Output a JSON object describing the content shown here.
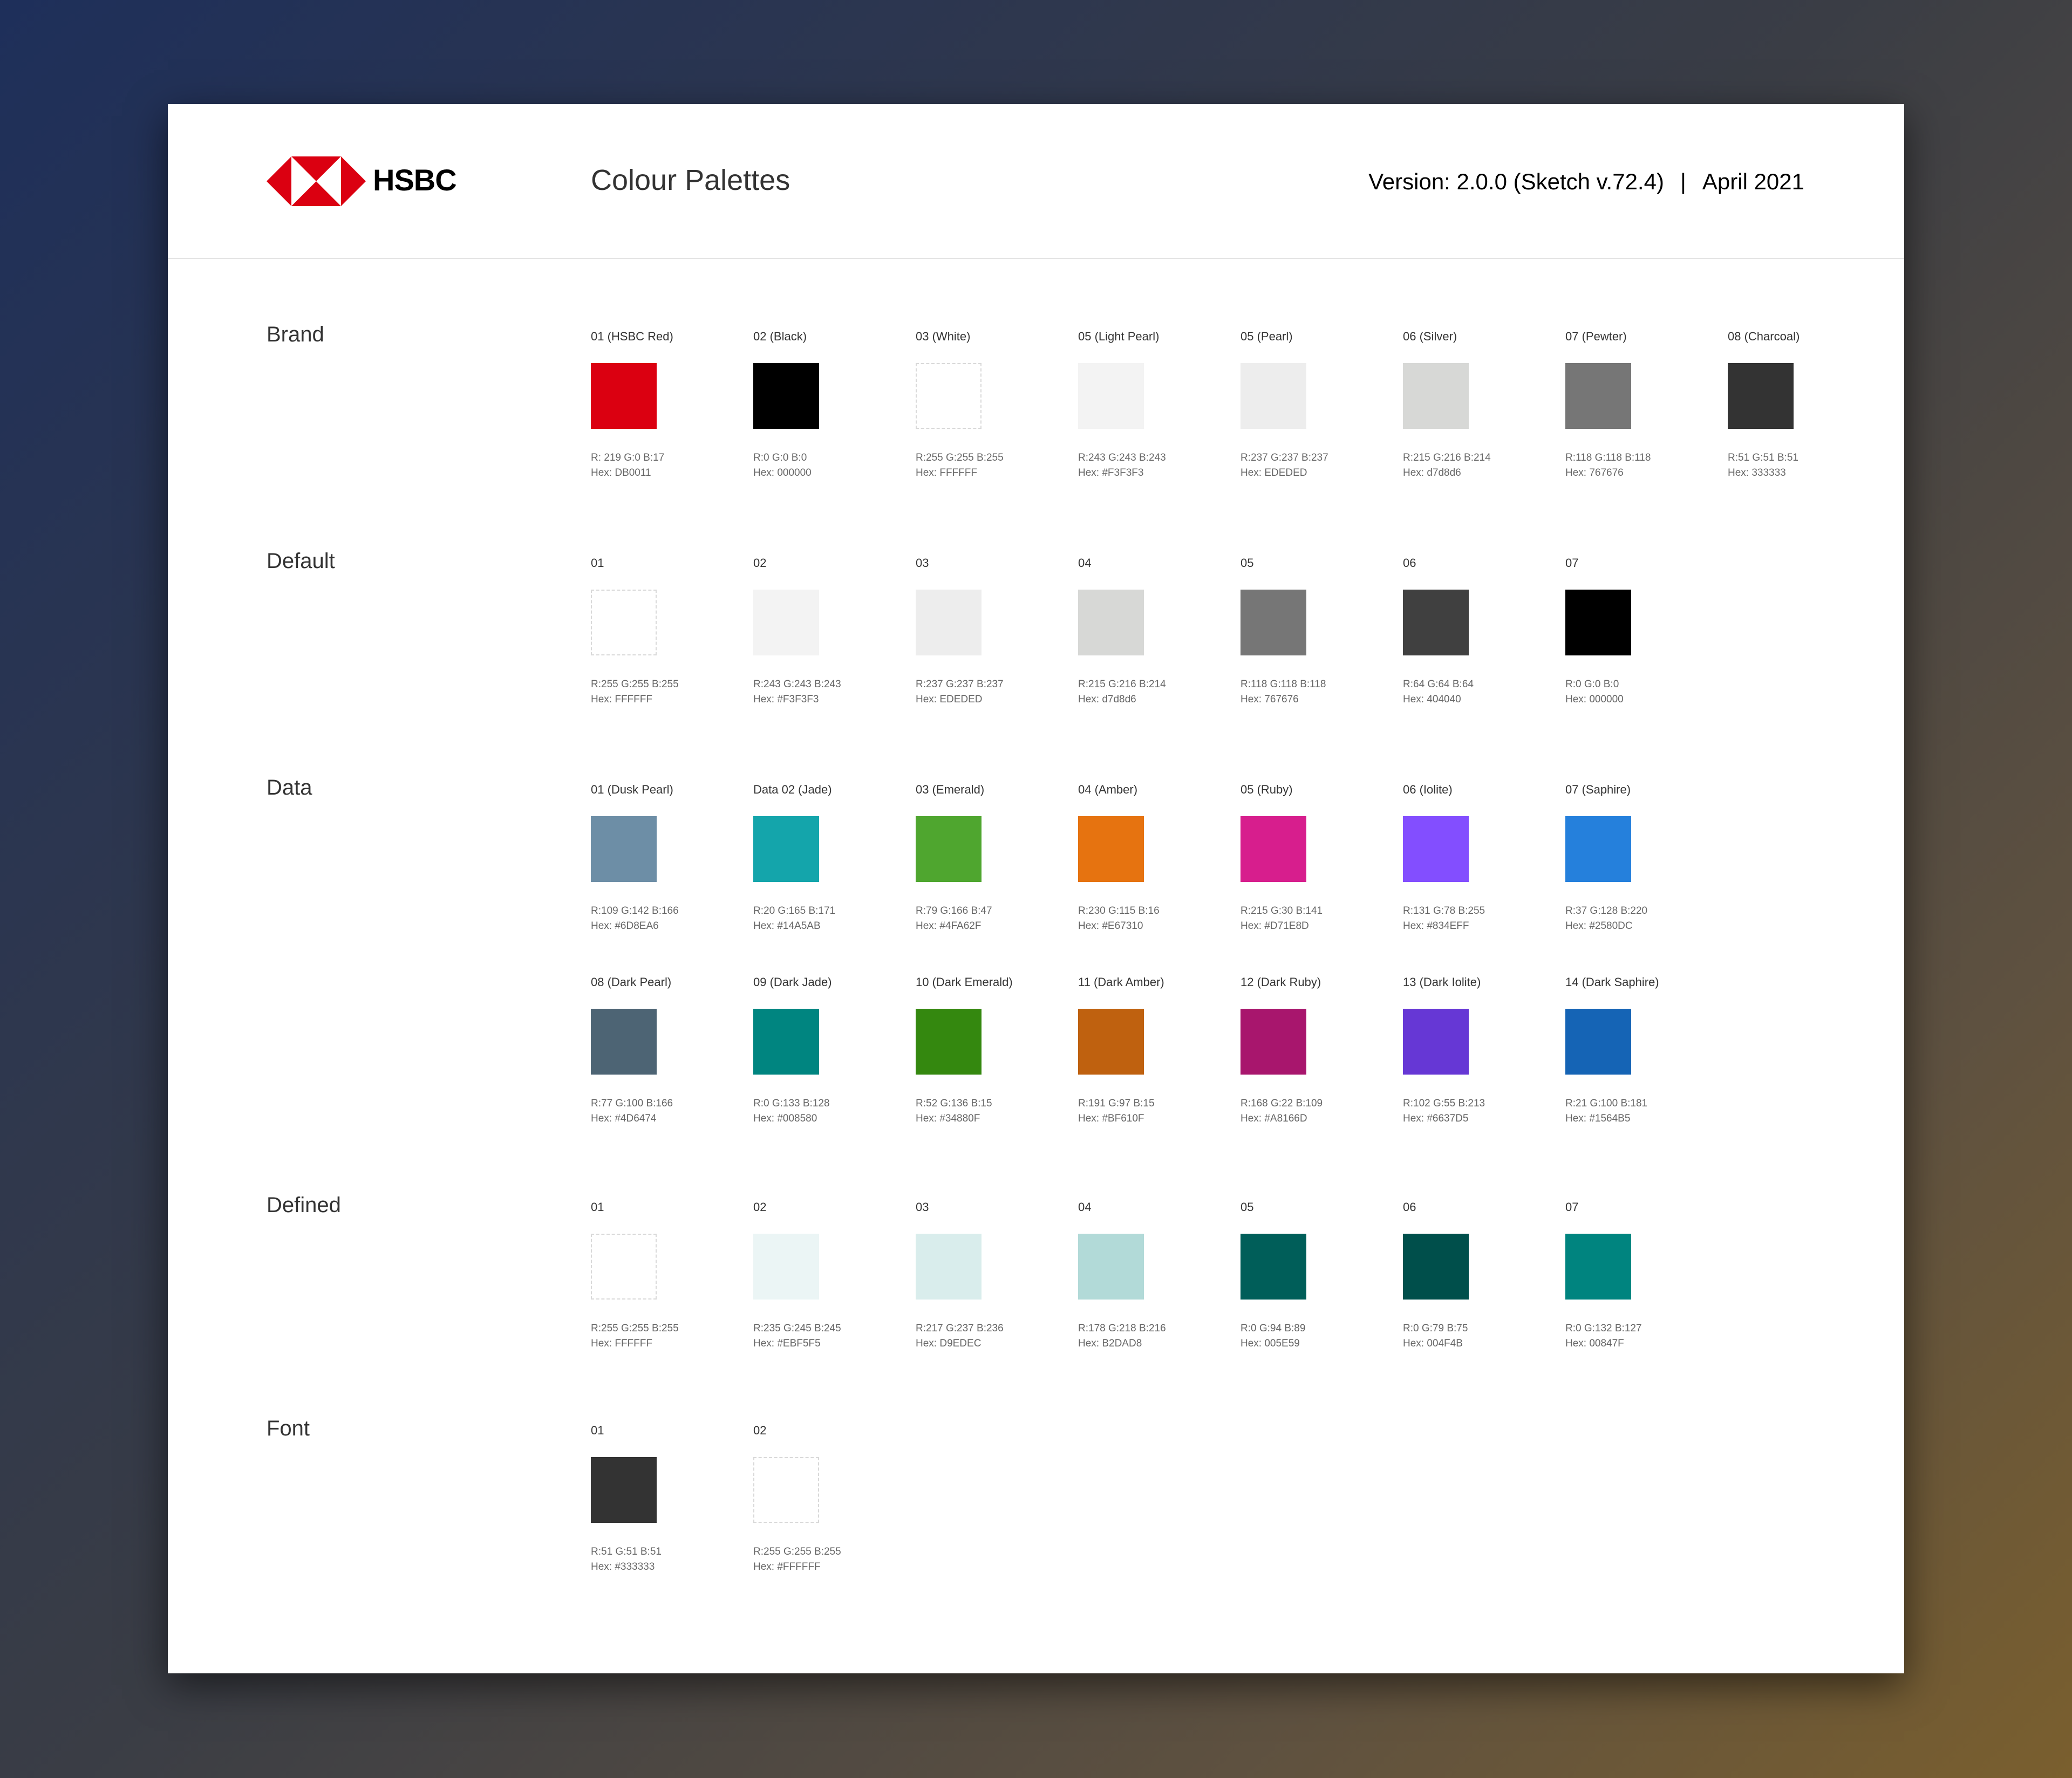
{
  "header": {
    "brand": "HSBC",
    "title": "Colour Palettes",
    "version": "Version: 2.0.0 (Sketch v.72.4)",
    "separator": "|",
    "date": "April 2021"
  },
  "sections": [
    {
      "label": "Brand",
      "rows": [
        [
          {
            "name": "01 (HSBC Red)",
            "color": "#DB0011",
            "rgb": "R: 219 G:0 B:17",
            "hex": "Hex: DB0011"
          },
          {
            "name": "02 (Black)",
            "color": "#000000",
            "rgb": "R:0 G:0 B:0",
            "hex": "Hex: 000000"
          },
          {
            "name": "03 (White)",
            "color": "#FFFFFF",
            "rgb": "R:255 G:255 B:255",
            "hex": "Hex: FFFFFF"
          },
          {
            "name": "05 (Light Pearl)",
            "color": "#F3F3F3",
            "rgb": "R:243  G:243  B:243",
            "hex": "Hex: #F3F3F3"
          },
          {
            "name": "05 (Pearl)",
            "color": "#EDEDED",
            "rgb": "R:237 G:237 B:237",
            "hex": "Hex: EDEDED"
          },
          {
            "name": "06 (Silver)",
            "color": "#D7D8D6",
            "rgb": "R:215 G:216 B:214",
            "hex": "Hex: d7d8d6"
          },
          {
            "name": "07 (Pewter)",
            "color": "#767676",
            "rgb": "R:118 G:118 B:118",
            "hex": "Hex: 767676"
          },
          {
            "name": "08 (Charcoal)",
            "color": "#333333",
            "rgb": "R:51 G:51 B:51",
            "hex": "Hex: 333333"
          }
        ]
      ]
    },
    {
      "label": "Default",
      "rows": [
        [
          {
            "name": "01",
            "color": "#FFFFFF",
            "rgb": "R:255 G:255 B:255",
            "hex": "Hex: FFFFFF"
          },
          {
            "name": "02",
            "color": "#F3F3F3",
            "rgb": "R:243  G:243  B:243",
            "hex": "Hex: #F3F3F3"
          },
          {
            "name": "03",
            "color": "#EDEDED",
            "rgb": "R:237 G:237 B:237",
            "hex": "Hex: EDEDED"
          },
          {
            "name": "04",
            "color": "#D7D8D6",
            "rgb": "R:215 G:216 B:214",
            "hex": "Hex: d7d8d6"
          },
          {
            "name": "05",
            "color": "#767676",
            "rgb": "R:118 G:118 B:118",
            "hex": "Hex: 767676"
          },
          {
            "name": "06",
            "color": "#404040",
            "rgb": "R:64 G:64 B:64",
            "hex": "Hex: 404040"
          },
          {
            "name": "07",
            "color": "#000000",
            "rgb": "R:0 G:0 B:0",
            "hex": "Hex: 000000"
          }
        ]
      ]
    },
    {
      "label": "Data",
      "rows": [
        [
          {
            "name": "01 (Dusk Pearl)",
            "color": "#6D8EA6",
            "rgb": "R:109 G:142 B:166",
            "hex": "Hex: #6D8EA6"
          },
          {
            "name": "Data 02 (Jade)",
            "color": "#14A5AB",
            "rgb": "R:20 G:165 B:171",
            "hex": "Hex: #14A5AB"
          },
          {
            "name": "03 (Emerald)",
            "color": "#4FA62F",
            "rgb": "R:79 G:166 B:47",
            "hex": "Hex: #4FA62F"
          },
          {
            "name": "04 (Amber)",
            "color": "#E67310",
            "rgb": "R:230 G:115 B:16",
            "hex": "Hex: #E67310"
          },
          {
            "name": "05 (Ruby)",
            "color": "#D71E8D",
            "rgb": "R:215 G:30 B:141",
            "hex": "Hex: #D71E8D"
          },
          {
            "name": "06 (Iolite)",
            "color": "#834EFF",
            "rgb": "R:131 G:78 B:255",
            "hex": "Hex: #834EFF"
          },
          {
            "name": "07 (Saphire)",
            "color": "#2580DC",
            "rgb": "R:37 G:128 B:220",
            "hex": "Hex: #2580DC"
          }
        ],
        [
          {
            "name": "08 (Dark Pearl)",
            "color": "#4D6474",
            "rgb": "R:77 G:100 B:166",
            "hex": "Hex: #4D6474"
          },
          {
            "name": "09 (Dark Jade)",
            "color": "#008580",
            "rgb": "R:0 G:133 B:128",
            "hex": "Hex: #008580"
          },
          {
            "name": "10 (Dark Emerald)",
            "color": "#34880F",
            "rgb": "R:52 G:136 B:15",
            "hex": "Hex: #34880F"
          },
          {
            "name": "11 (Dark Amber)",
            "color": "#BF610F",
            "rgb": "R:191 G:97 B:15",
            "hex": "Hex: #BF610F"
          },
          {
            "name": "12 (Dark Ruby)",
            "color": "#A8166D",
            "rgb": "R:168 G:22 B:109",
            "hex": "Hex: #A8166D"
          },
          {
            "name": "13 (Dark Iolite)",
            "color": "#6637D5",
            "rgb": "R:102 G:55 B:213",
            "hex": "Hex: #6637D5"
          },
          {
            "name": "14 (Dark Saphire)",
            "color": "#1564B5",
            "rgb": "R:21 G:100 B:181",
            "hex": "Hex: #1564B5"
          }
        ]
      ]
    },
    {
      "label": "Defined",
      "rows": [
        [
          {
            "name": "01",
            "color": "#FFFFFF",
            "rgb": "R:255 G:255 B:255",
            "hex": "Hex: FFFFFF"
          },
          {
            "name": "02",
            "color": "#EBF5F5",
            "rgb": "R:235 G:245 B:245",
            "hex": "Hex: #EBF5F5"
          },
          {
            "name": "03",
            "color": "#D9EDEC",
            "rgb": "R:217 G:237 B:236",
            "hex": "Hex: D9EDEC"
          },
          {
            "name": "04",
            "color": "#B2DAD8",
            "rgb": "R:178 G:218 B:216",
            "hex": "Hex: B2DAD8"
          },
          {
            "name": "05",
            "color": "#005E59",
            "rgb": "R:0 G:94 B:89",
            "hex": "Hex: 005E59"
          },
          {
            "name": "06",
            "color": "#004F4B",
            "rgb": "R:0 G:79 B:75",
            "hex": "Hex: 004F4B"
          },
          {
            "name": "07",
            "color": "#00847F",
            "rgb": "R:0 G:132 B:127",
            "hex": "Hex: 00847F"
          }
        ]
      ]
    },
    {
      "label": "Font",
      "rows": [
        [
          {
            "name": "01",
            "color": "#333333",
            "rgb": "R:51 G:51 B:51",
            "hex": "Hex: #333333"
          },
          {
            "name": "02",
            "color": "#FFFFFF",
            "rgb": "R:255 G:255 B:255",
            "hex": "Hex: #FFFFFF"
          }
        ]
      ]
    }
  ]
}
